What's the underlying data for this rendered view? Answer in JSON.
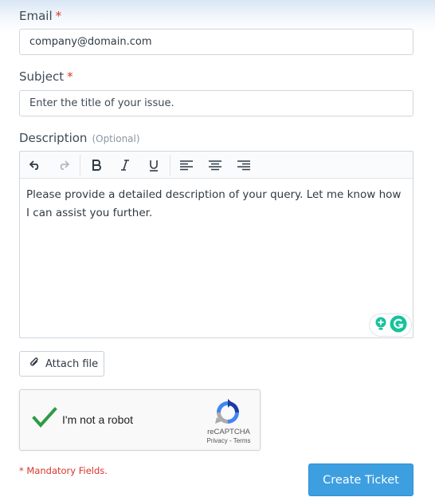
{
  "form": {
    "email": {
      "label": "Email",
      "required_mark": "*",
      "value": "company@domain.com"
    },
    "subject": {
      "label": "Subject",
      "required_mark": "*",
      "placeholder": "Enter the title of your issue."
    },
    "description": {
      "label": "Description",
      "optional_note": "(Optional)",
      "body": "Please provide a detailed description of your query. Let me know how I can assist you further."
    },
    "toolbar": {
      "buttons": [
        "undo-icon",
        "redo-icon",
        "bold-icon",
        "italic-icon",
        "underline-icon",
        "align-left-icon",
        "align-center-icon",
        "align-right-icon"
      ]
    },
    "attach_label": "Attach file",
    "recaptcha": {
      "checkbox_label": "I'm not a robot",
      "brand": "reCAPTCHA",
      "links": "Privacy - Terms",
      "checked": true
    },
    "mandatory_note": "* Mandatory Fields.",
    "submit_label": "Create Ticket"
  },
  "colors": {
    "accent": "#3d9fe0",
    "required": "#d9362b",
    "check": "#2e9a47",
    "grammarly": "#15c39a"
  }
}
